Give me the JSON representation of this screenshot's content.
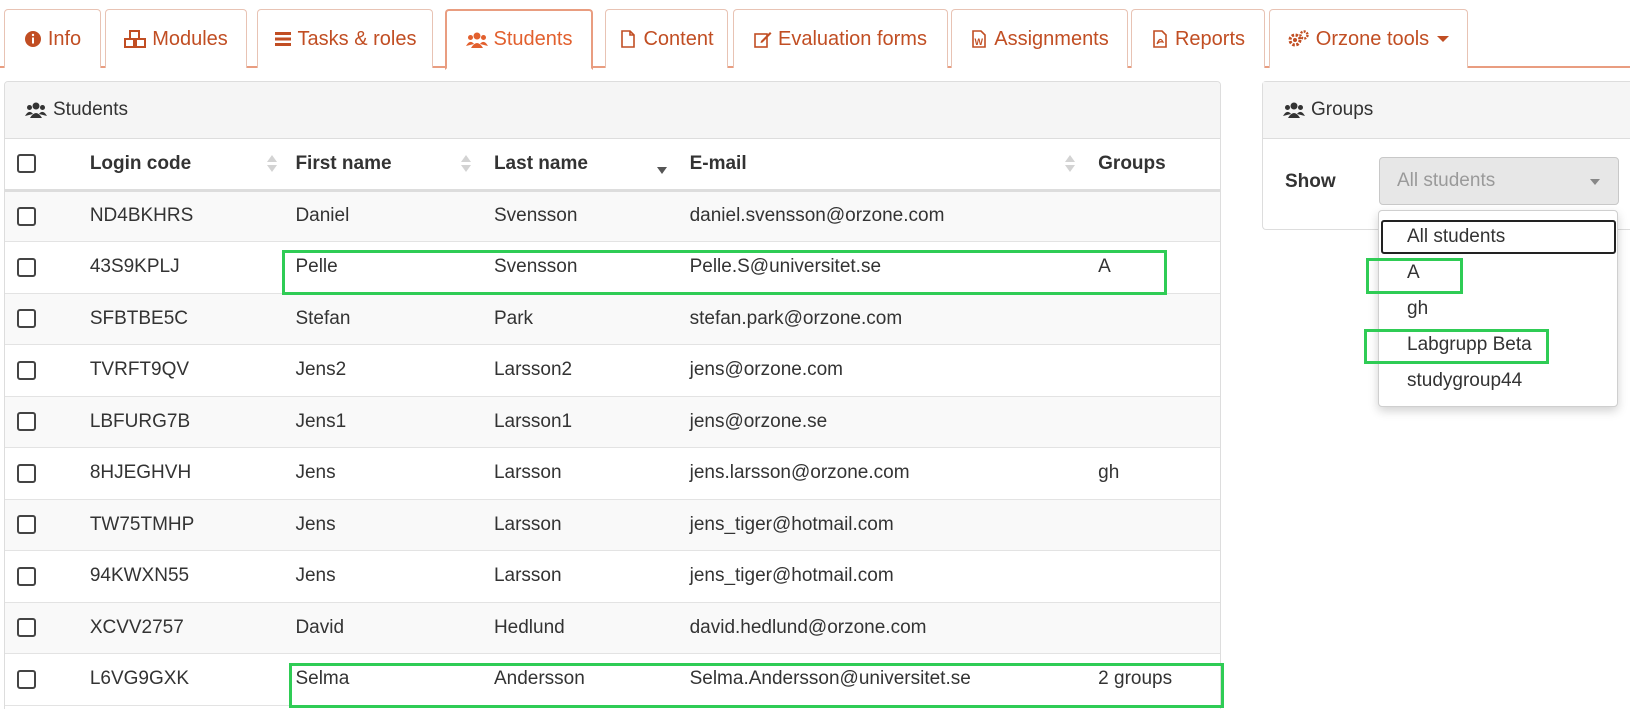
{
  "tabs": [
    {
      "label": "Info",
      "icon": "info-circle-icon"
    },
    {
      "label": "Modules",
      "icon": "cubes-icon"
    },
    {
      "label": "Tasks & roles",
      "icon": "tasks-icon"
    },
    {
      "label": "Students",
      "icon": "users-icon",
      "active": true
    },
    {
      "label": "Content",
      "icon": "file-icon"
    },
    {
      "label": "Evaluation forms",
      "icon": "edit-icon"
    },
    {
      "label": "Assignments",
      "icon": "word-file-icon"
    },
    {
      "label": "Reports",
      "icon": "pdf-file-icon"
    },
    {
      "label": "Orzone tools",
      "icon": "cogs-icon",
      "dropdown": true
    }
  ],
  "students": {
    "heading": "Students",
    "columns": [
      "Login code",
      "First name",
      "Last name",
      "E-mail",
      "Groups"
    ],
    "sorted_column": "Last name",
    "rows": [
      {
        "login": "ND4BKHRS",
        "first": "Daniel",
        "last": "Svensson",
        "email": "daniel.svensson@orzone.com",
        "groups": ""
      },
      {
        "login": "43S9KPLJ",
        "first": "Pelle",
        "last": "Svensson",
        "email": "Pelle.S@universitet.se",
        "groups": "A"
      },
      {
        "login": "SFBTBE5C",
        "first": "Stefan",
        "last": "Park",
        "email": "stefan.park@orzone.com",
        "groups": ""
      },
      {
        "login": "TVRFT9QV",
        "first": "Jens2",
        "last": "Larsson2",
        "email": "jens@orzone.com",
        "groups": ""
      },
      {
        "login": "LBFURG7B",
        "first": "Jens1",
        "last": "Larsson1",
        "email": "jens@orzone.se",
        "groups": ""
      },
      {
        "login": "8HJEGHVH",
        "first": "Jens",
        "last": "Larsson",
        "email": "jens.larsson@orzone.com",
        "groups": "gh"
      },
      {
        "login": "TW75TMHP",
        "first": "Jens",
        "last": "Larsson",
        "email": "jens_tiger@hotmail.com",
        "groups": ""
      },
      {
        "login": "94KWXN55",
        "first": "Jens",
        "last": "Larsson",
        "email": "jens_tiger@hotmail.com",
        "groups": ""
      },
      {
        "login": "XCVV2757",
        "first": "David",
        "last": "Hedlund",
        "email": "david.hedlund@orzone.com",
        "groups": ""
      },
      {
        "login": "L6VG9GXK",
        "first": "Selma",
        "last": "Andersson",
        "email": "Selma.Andersson@universitet.se",
        "groups": "2 groups"
      }
    ]
  },
  "groups": {
    "heading": "Groups",
    "show_label": "Show",
    "selected": "All students",
    "options": [
      "All students",
      "A",
      "gh",
      "Labgrupp Beta",
      "studygroup44"
    ]
  },
  "colors": {
    "accent": "#e2602e",
    "tab_text": "#c14e23",
    "highlight": "#2fcc55"
  }
}
